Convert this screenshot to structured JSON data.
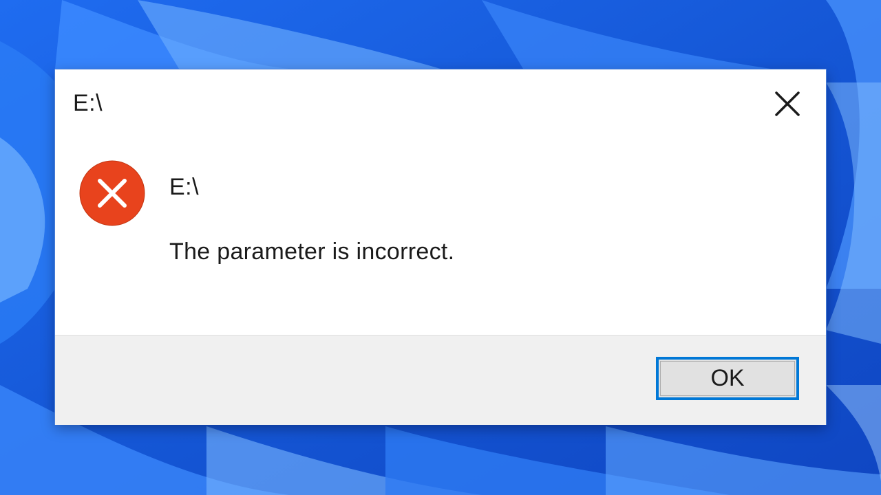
{
  "dialog": {
    "title": "E:\\",
    "close_icon": "close-icon",
    "icon": "error-icon",
    "heading": "E:\\",
    "message": "The parameter is incorrect.",
    "ok_label": "OK"
  },
  "colors": {
    "desktop_blue": "#1a5fe0",
    "error_red": "#e8431d",
    "button_focus_border": "#0078d7",
    "footer_bg": "#f0f0f0",
    "button_bg": "#e1e1e1"
  }
}
